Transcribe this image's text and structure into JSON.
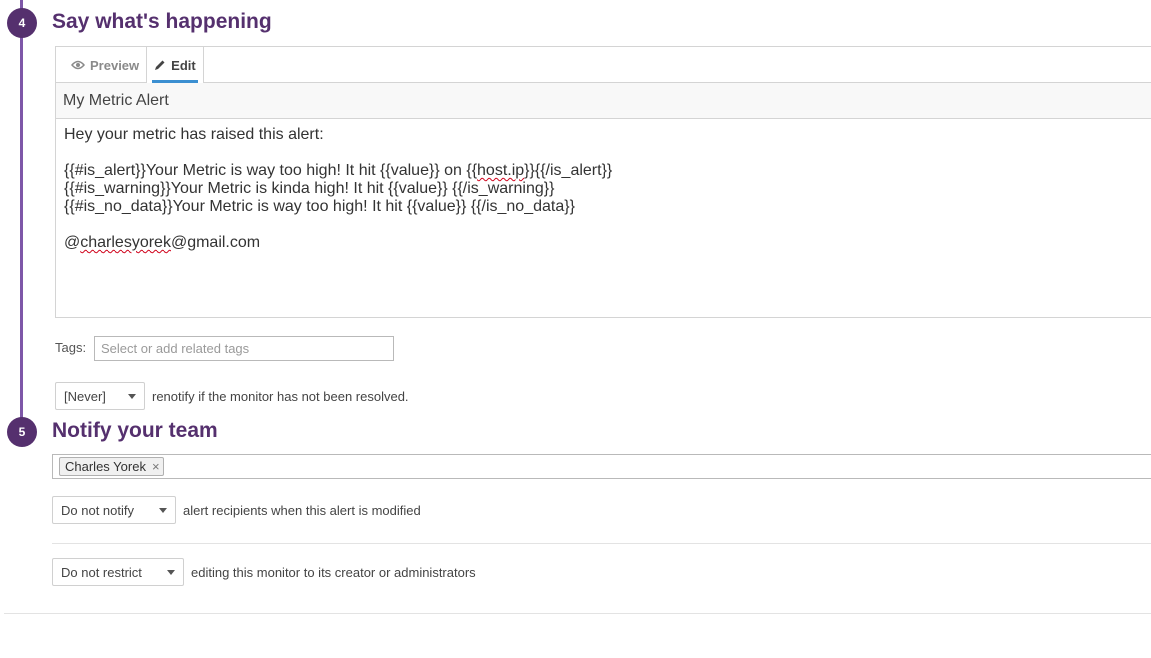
{
  "steps": {
    "say": {
      "number": "4",
      "title": "Say what's happening"
    },
    "notify": {
      "number": "5",
      "title": "Notify your team"
    }
  },
  "editor": {
    "tabs": [
      {
        "label": "Preview",
        "icon": "eye-icon"
      },
      {
        "label": "Edit",
        "icon": "pencil-icon"
      }
    ],
    "active_tab": "Edit",
    "title_value": "My Metric Alert",
    "body": {
      "line1": "Hey your metric has raised this alert:",
      "line2_pre": "{{#is_alert}}Your Metric is way too high! It hit {{value}} on {{",
      "line2_mis": "host.ip",
      "line2_post": "}}{{/is_alert}}",
      "line3": "{{#is_warning}}Your Metric is kinda high! It hit {{value}} {{/is_warning}}",
      "line4": "{{#is_no_data}}Your Metric is way too high! It hit {{value}} {{/is_no_data}}",
      "line5_pre": "@",
      "line5_mis": "charlesyorek",
      "line5_post": "@gmail.com"
    }
  },
  "tags": {
    "label": "Tags:",
    "placeholder": "Select or add related tags"
  },
  "renotify": {
    "value": "[Never]",
    "text": "renotify if the monitor has not been resolved."
  },
  "notify": {
    "recipients": [
      {
        "name": "Charles Yorek",
        "remove": "×"
      }
    ],
    "modify_select": "Do not notify",
    "modify_text": "alert recipients when this alert is modified",
    "restrict_select": "Do not restrict",
    "restrict_text": "editing this monitor to its creator or administrators"
  },
  "colors": {
    "accent_purple": "#55306e",
    "step_line": "#7e57a8",
    "tab_underline": "#3b8fd1",
    "spell_error": "#d0021b"
  }
}
